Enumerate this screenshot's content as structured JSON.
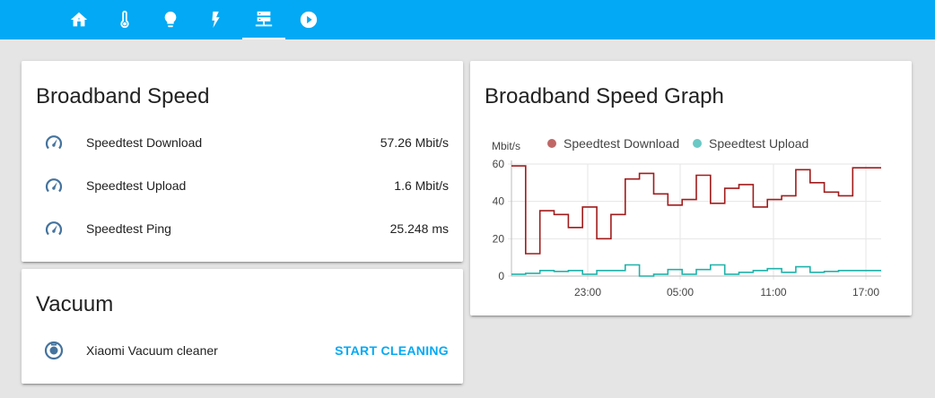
{
  "colors": {
    "header": "#03a9f4",
    "icon": "#44739e",
    "accent": "#03a9f4",
    "download": "#a11c1c",
    "download_dot": "#c06766",
    "upload": "#20b2aa",
    "upload_dot": "#68c9c5"
  },
  "tabs": [
    {
      "icon": "home-icon"
    },
    {
      "icon": "thermometer-icon"
    },
    {
      "icon": "lightbulb-icon"
    },
    {
      "icon": "flash-icon"
    },
    {
      "icon": "server-network-icon",
      "active": true
    },
    {
      "icon": "play-circle-icon"
    }
  ],
  "broadband": {
    "title": "Broadband Speed",
    "rows": [
      {
        "icon": "speedometer-icon",
        "name": "Speedtest Download",
        "value": "57.26 Mbit/s"
      },
      {
        "icon": "speedometer-icon",
        "name": "Speedtest Upload",
        "value": "1.6 Mbit/s"
      },
      {
        "icon": "speedometer-icon",
        "name": "Speedtest Ping",
        "value": "25.248 ms"
      }
    ]
  },
  "vacuum": {
    "title": "Vacuum",
    "row": {
      "icon": "robot-vacuum-icon",
      "name": "Xiaomi Vacuum cleaner",
      "action": "START CLEANING"
    }
  },
  "graph": {
    "title": "Broadband Speed Graph"
  },
  "chart_data": {
    "type": "line",
    "step": true,
    "ylabel": "Mbit/s",
    "ylim": [
      0,
      60
    ],
    "yticks": [
      0,
      20,
      40,
      60
    ],
    "x_tick_labels": [
      "23:00",
      "05:00",
      "11:00",
      "17:00"
    ],
    "legend_position": "top",
    "grid": true,
    "series": [
      {
        "name": "Speedtest Download",
        "color": "#a11c1c",
        "values": [
          59,
          12,
          35,
          33,
          26,
          37,
          20,
          33,
          52,
          55,
          44,
          38,
          41,
          54,
          39,
          47,
          49,
          37,
          41,
          43,
          57,
          50,
          45,
          43,
          58,
          58
        ]
      },
      {
        "name": "Speedtest Upload",
        "color": "#20b2aa",
        "values": [
          1,
          1.5,
          3,
          2.5,
          3,
          1,
          3,
          3,
          6,
          0,
          1,
          3.5,
          1,
          3.5,
          6,
          1,
          2,
          3,
          4,
          2,
          5,
          2,
          2.5,
          3,
          3,
          3
        ]
      }
    ]
  }
}
